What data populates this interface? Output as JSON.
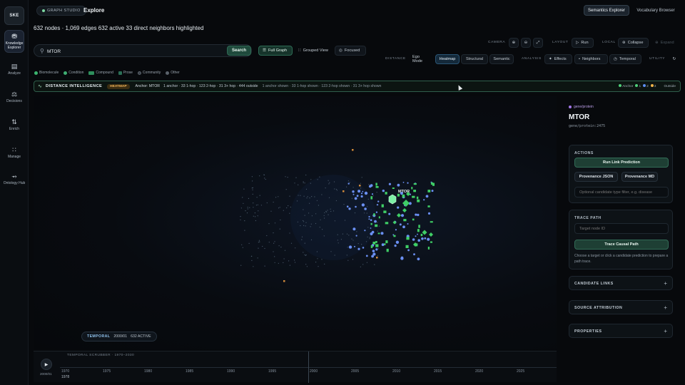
{
  "rail": {
    "logo": "SKE",
    "items": [
      {
        "label": "Knowledge Explorer",
        "icon": "database-icon",
        "active": true
      },
      {
        "label": "Analyze",
        "icon": "document-icon"
      },
      {
        "label": "Decisions",
        "icon": "scales-icon"
      },
      {
        "label": "Enrich",
        "icon": "branch-icon"
      },
      {
        "label": "Manage",
        "icon": "nodes-icon"
      },
      {
        "label": "Ontology Hub",
        "icon": "ontology-icon"
      }
    ]
  },
  "header": {
    "studio": "GRAPH STUDIO",
    "title": "Explore",
    "tabs": [
      "Semantics Explorer",
      "Vocabulary Browser"
    ],
    "stats": "632 nodes · 1,069 edges  632 active  33 direct neighbors highlighted"
  },
  "toolbar": {
    "camera_label": "CAMERA",
    "layout_label": "LAYOUT",
    "run_label": "Run",
    "local_label": "LOCAL",
    "collapse_label": "Collapse",
    "expand_label": "Expand",
    "search_value": "MTOR",
    "search_button": "Search",
    "views": [
      "Full Graph",
      "Grouped View",
      "Focused"
    ],
    "distance_label": "DISTANCE",
    "distance_modes": [
      "Ego Mode",
      "Heatmap",
      "Structural",
      "Semantic"
    ],
    "analysis_label": "ANALYSIS",
    "analysis_items": [
      "Effects",
      "Neighbors",
      "Temporal"
    ],
    "utility_label": "UTILITY"
  },
  "legend": [
    {
      "label": "Biomolecule",
      "color": "#3bb46e"
    },
    {
      "label": "Condition",
      "color": "#3fae73"
    },
    {
      "label": "Compound",
      "color": "#2e8f5c"
    },
    {
      "label": "Prose",
      "color": "#2a6e55"
    },
    {
      "label": "Community",
      "color": "#3a4048"
    },
    {
      "label": "Other",
      "color": "#5a626b"
    }
  ],
  "intel": {
    "title": "DISTANCE INTELLIGENCE",
    "badge": "HEATMAP",
    "anchor": "Anchor: MTOR",
    "summary": "1 anchor · 33 1-hop · 123 2-hop · 31 3+ hop · 444 outside",
    "shown": "1 anchor shown · 33 1-hop shown · 123 2-hop shown · 31 3+ hop shown",
    "legend_anchor": "Anchor",
    "legend_1": "1",
    "legend_2": "2",
    "legend_3": "3",
    "legend_outside": "Outside",
    "colors": {
      "anchor": "#4fcf7a",
      "hop1": "#4fcf7a",
      "hop2": "#5b8df0",
      "hop3": "#f0b54a"
    }
  },
  "graph": {
    "anchor_label": "MTOR",
    "anchor_color": "#7ef0a6",
    "hop1_color": "#3fcf66",
    "hop2_color": "#6a8ff2",
    "outside_color": "#4a5a6c"
  },
  "temporal": {
    "key": "TEMPORAL",
    "date": "2000/01",
    "active": "632 ACTIVE",
    "scrubber_label": "TEMPORAL SCRUBBER · 1970–2030",
    "current_date": "2000/01",
    "current_year": "1978",
    "ticks": [
      "1970",
      "1975",
      "1980",
      "1985",
      "1990",
      "1995",
      "2000",
      "2005",
      "2010",
      "2015",
      "2020",
      "2025"
    ]
  },
  "panel": {
    "type": "gene/protein",
    "name": "MTOR",
    "id": "gene/protein:2475",
    "actions_title": "ACTIONS",
    "run_link": "Run Link Prediction",
    "prov_json": "Provenance JSON",
    "prov_md": "Provenance MD",
    "filter_placeholder": "Optional candidate type filter, e.g. disease",
    "trace_title": "TRACE PATH",
    "target_placeholder": "Target node ID",
    "trace_button": "Trace Causal Path",
    "trace_hint": "Choose a target or click a candidate prediction to prepare a path trace.",
    "sections": [
      "CANDIDATE LINKS",
      "SOURCE ATTRIBUTION",
      "PROPERTIES"
    ]
  }
}
